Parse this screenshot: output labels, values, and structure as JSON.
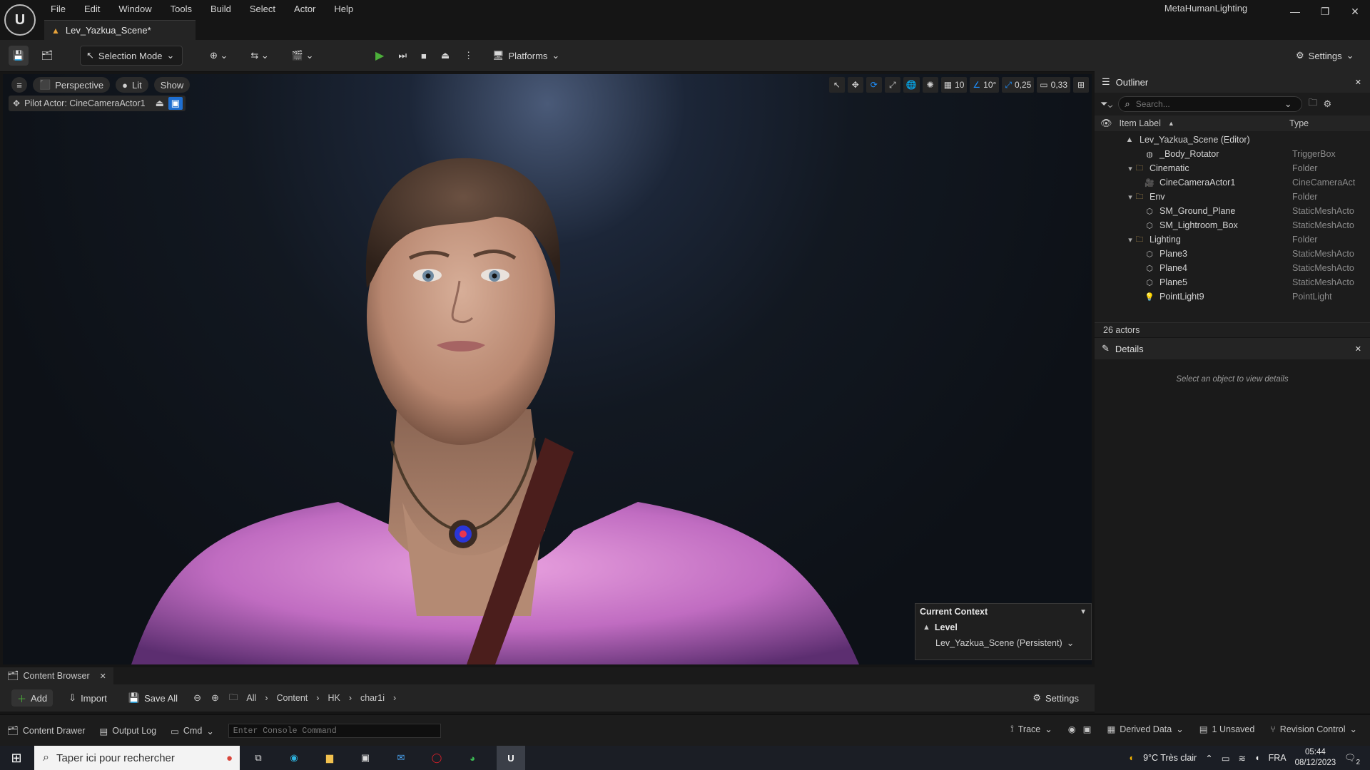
{
  "titlebar": {
    "menu": [
      "File",
      "Edit",
      "Window",
      "Tools",
      "Build",
      "Select",
      "Actor",
      "Help"
    ],
    "doc_tab": "Lev_Yazkua_Scene*",
    "project": "MetaHumanLighting"
  },
  "toolbar": {
    "selection_mode": "Selection Mode",
    "platforms": "Platforms",
    "settings": "Settings"
  },
  "viewport": {
    "perspective": "Perspective",
    "lit": "Lit",
    "show": "Show",
    "pilot_actor": "Pilot Actor: CineCameraActor1",
    "grid_snap": "10",
    "rotation_snap": "10°",
    "scale_snap": "0,25",
    "camera_speed": "0,33",
    "context": {
      "title": "Current Context",
      "level_label": "Level",
      "level_value": "Lev_Yazkua_Scene (Persistent)"
    }
  },
  "outliner": {
    "title": "Outliner",
    "search_placeholder": "Search...",
    "col_label": "Item Label",
    "col_type": "Type",
    "items": [
      {
        "label": "Lev_Yazkua_Scene (Editor)",
        "type": "",
        "indent": 0,
        "icon": "level-icon",
        "expand": false
      },
      {
        "label": "_Body_Rotator",
        "type": "TriggerBox",
        "indent": 2,
        "icon": "trigger-icon",
        "expand": false
      },
      {
        "label": "Cinematic",
        "type": "Folder",
        "indent": 1,
        "icon": "folder-icon",
        "expand": true
      },
      {
        "label": "CineCameraActor1",
        "type": "CineCameraAct",
        "indent": 2,
        "icon": "camera-icon",
        "expand": false
      },
      {
        "label": "Env",
        "type": "Folder",
        "indent": 1,
        "icon": "folder-icon",
        "expand": true
      },
      {
        "label": "SM_Ground_Plane",
        "type": "StaticMeshActo",
        "indent": 2,
        "icon": "mesh-icon",
        "expand": false
      },
      {
        "label": "SM_Lightroom_Box",
        "type": "StaticMeshActo",
        "indent": 2,
        "icon": "mesh-icon",
        "expand": false
      },
      {
        "label": "Lighting",
        "type": "Folder",
        "indent": 1,
        "icon": "folder-icon",
        "expand": true
      },
      {
        "label": "Plane3",
        "type": "StaticMeshActo",
        "indent": 2,
        "icon": "mesh-icon",
        "expand": false
      },
      {
        "label": "Plane4",
        "type": "StaticMeshActo",
        "indent": 2,
        "icon": "mesh-icon",
        "expand": false
      },
      {
        "label": "Plane5",
        "type": "StaticMeshActo",
        "indent": 2,
        "icon": "mesh-icon",
        "expand": false
      },
      {
        "label": "PointLight9",
        "type": "PointLight",
        "indent": 2,
        "icon": "light-icon",
        "expand": false
      }
    ],
    "actor_count": "26 actors"
  },
  "details": {
    "title": "Details",
    "empty_text": "Select an object to view details"
  },
  "content_browser": {
    "tab": "Content Browser",
    "add": "Add",
    "import": "Import",
    "save_all": "Save All",
    "path": [
      "All",
      "Content",
      "HK",
      "char1i"
    ],
    "settings": "Settings"
  },
  "status_bar": {
    "content_drawer": "Content Drawer",
    "output_log": "Output Log",
    "cmd": "Cmd",
    "console_placeholder": "Enter Console Command",
    "trace": "Trace",
    "derived_data": "Derived Data",
    "unsaved": "1 Unsaved",
    "revision_control": "Revision Control"
  },
  "taskbar": {
    "search_placeholder": "Taper ici pour rechercher",
    "weather": "9°C  Très clair",
    "language": "FRA",
    "time": "05:44",
    "date": "08/12/2023",
    "notification_count": "2"
  }
}
